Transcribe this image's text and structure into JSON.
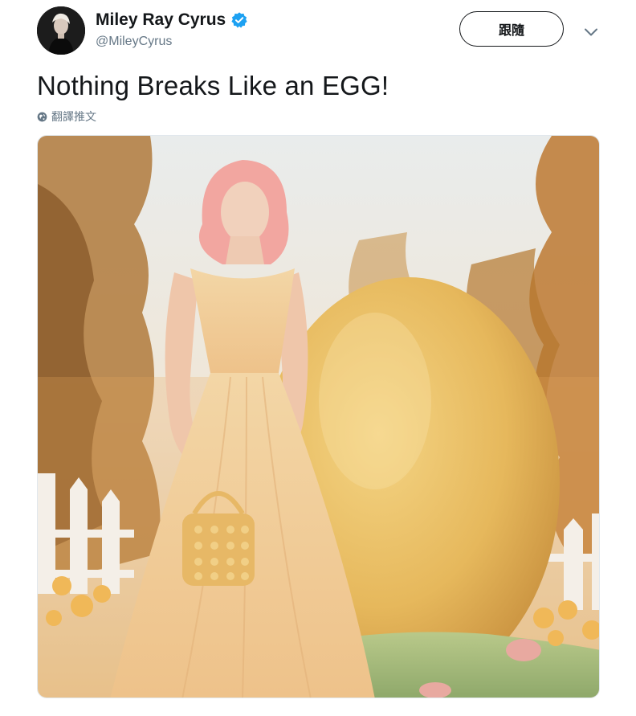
{
  "user": {
    "display_name": "Miley Ray Cyrus",
    "handle": "@MileyCyrus",
    "verified": true,
    "avatar_icon": "avatar-photo"
  },
  "actions": {
    "follow_label": "跟隨",
    "more_icon": "chevron-down-icon"
  },
  "tweet": {
    "text": "Nothing Breaks Like an EGG!",
    "translate_label": "翻譯推文",
    "translate_icon": "globe-icon"
  },
  "colors": {
    "verified": "#1da1f2",
    "text_primary": "#14171a",
    "text_secondary": "#657786",
    "border": "#e1e8ed"
  }
}
